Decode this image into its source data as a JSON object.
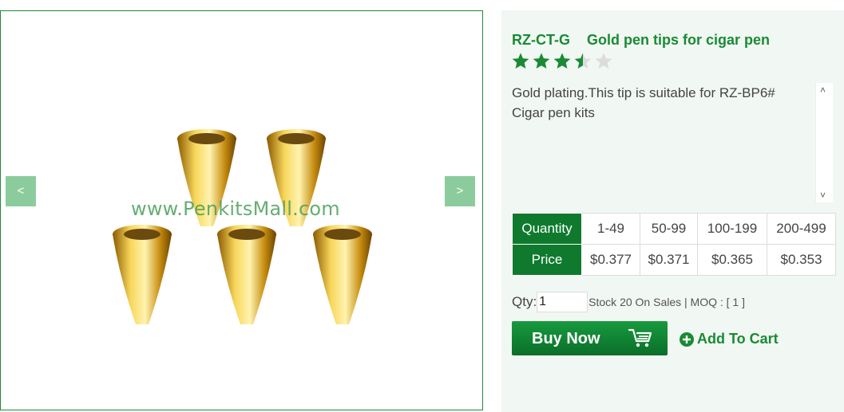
{
  "gallery": {
    "prev_label": "<",
    "next_label": ">",
    "watermark": "www.PenkitsMall.com"
  },
  "product": {
    "sku": "RZ-CT-G",
    "name": "Gold pen tips for cigar pen",
    "rating": 3.5,
    "rating_max": 5,
    "description": "Gold plating.This tip is suitable for RZ-BP6# Cigar pen kits"
  },
  "pricing": {
    "quantity_label": "Quantity",
    "price_label": "Price",
    "tiers": [
      {
        "range": "1-49",
        "price": "$0.377"
      },
      {
        "range": "50-99",
        "price": "$0.371"
      },
      {
        "range": "100-199",
        "price": "$0.365"
      },
      {
        "range": "200-499",
        "price": "$0.353"
      }
    ]
  },
  "order": {
    "qty_label": "Qty:",
    "qty_value": "1",
    "stock_text": "Stock 20 On Sales | MOQ : [ 1 ]",
    "buy_now_label": "Buy Now",
    "add_to_cart_label": "Add To Cart"
  },
  "colors": {
    "brand_green": "#1a8a35",
    "table_head": "#0f7a2e",
    "nav_button": "#8ccc9c",
    "panel_bg": "#f1f7f2",
    "gold": "#d4a017"
  }
}
